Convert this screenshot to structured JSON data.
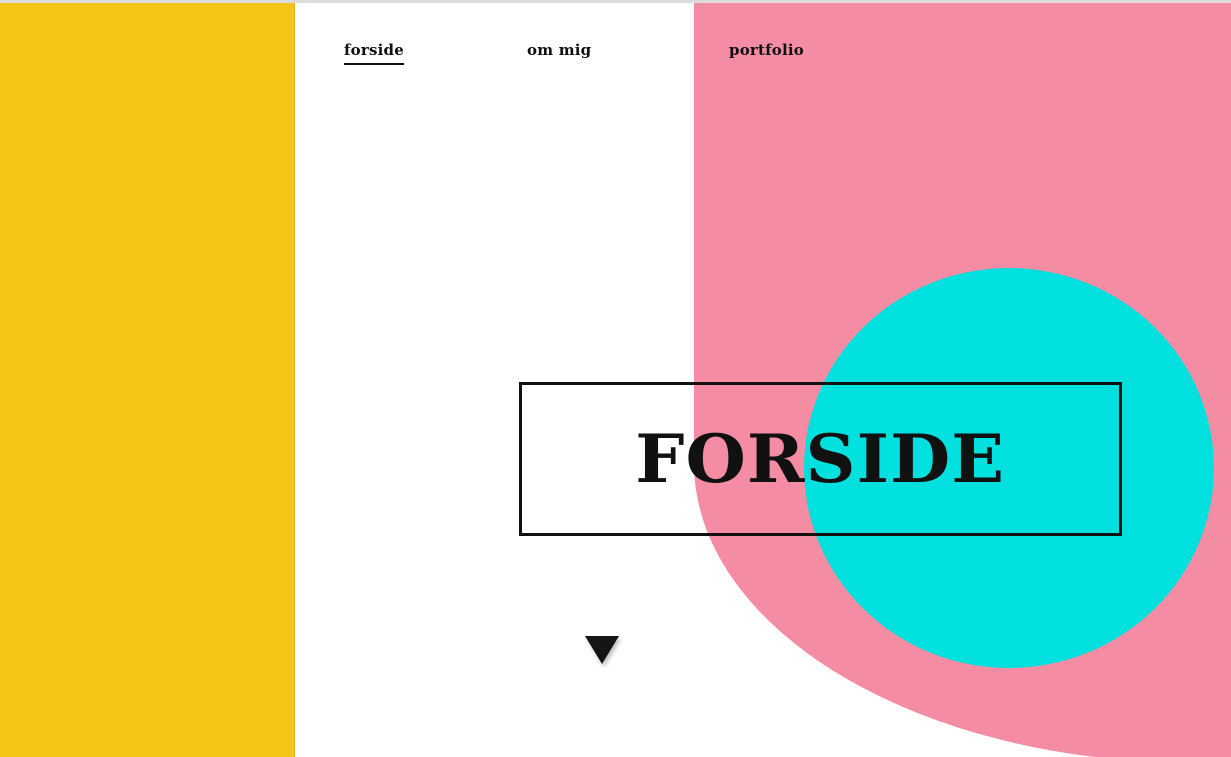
{
  "nav": {
    "items": [
      {
        "label": "forside",
        "active": true
      },
      {
        "label": "om mig",
        "active": false
      },
      {
        "label": "portfolio",
        "active": false
      }
    ]
  },
  "hero": {
    "title": "FORSIDE"
  },
  "icons": {
    "scroll_down": "triangle-down-icon"
  },
  "colors": {
    "yellow": "#f5c518",
    "pink": "#f48ca3",
    "cyan": "#00e0de",
    "text": "#111111"
  }
}
